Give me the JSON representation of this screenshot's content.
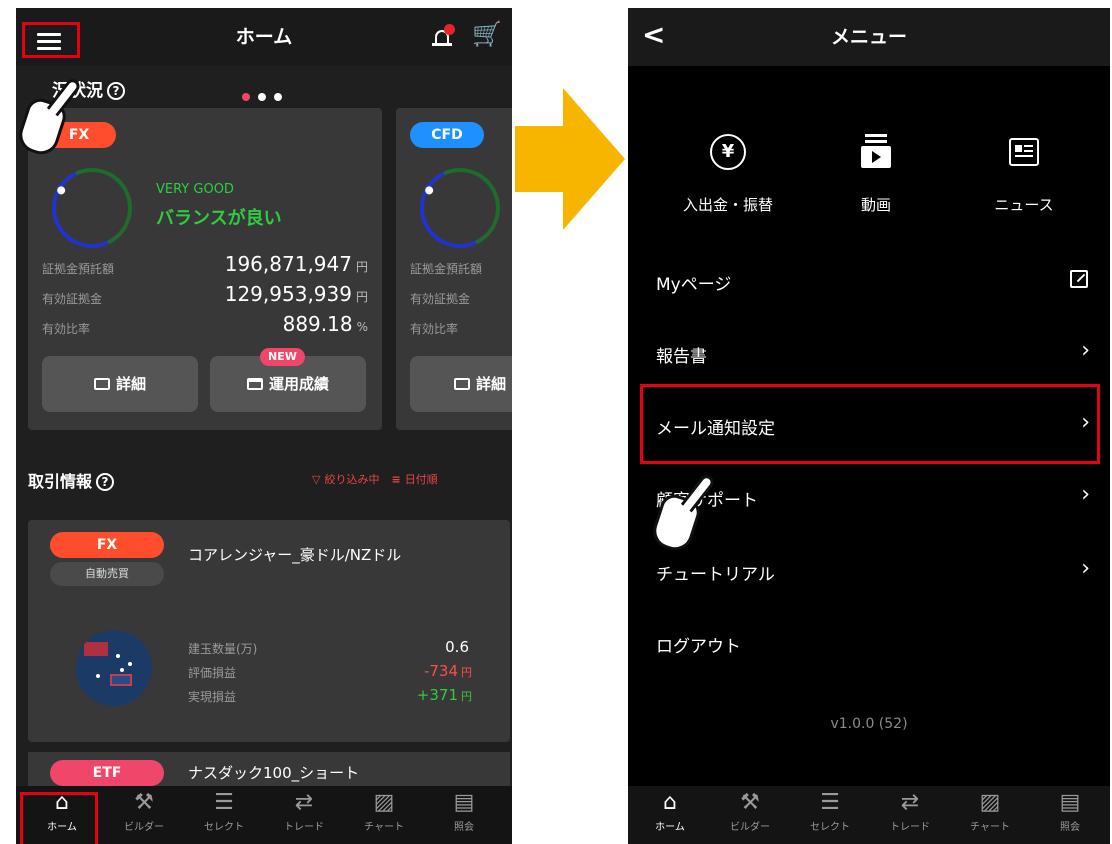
{
  "left": {
    "header": {
      "title": "ホーム"
    },
    "status_section": {
      "title": "況状況"
    },
    "card_fx": {
      "tag": "FX",
      "rating": "VERY GOOD",
      "rating_text": "バランスが良い",
      "rows": [
        {
          "label": "証拠金預託額",
          "value": "196,871,947",
          "unit": "円"
        },
        {
          "label": "有効証拠金",
          "value": "129,953,939",
          "unit": "円"
        },
        {
          "label": "有効比率",
          "value": "889.18",
          "unit": "%"
        }
      ],
      "detail_btn": "詳細",
      "perf_btn": "運用成績",
      "new_badge": "NEW"
    },
    "card_cfd": {
      "tag": "CFD",
      "rows": [
        "証拠金預託額",
        "有効証拠金",
        "有効比率"
      ],
      "detail_btn": "詳細"
    },
    "trade_section": {
      "title": "取引情報",
      "filter": "絞り込み中",
      "sort": "日付順"
    },
    "trade": {
      "tag": "FX",
      "auto": "自動売買",
      "name": "コアレンジャー_豪ドル/NZドル",
      "rows": [
        {
          "label": "建玉数量(万)",
          "value": "0.6",
          "unit": "",
          "color": "#ffffff"
        },
        {
          "label": "評価損益",
          "value": "-734",
          "unit": "円",
          "color": "#ff4d4d"
        },
        {
          "label": "実現損益",
          "value": "+371",
          "unit": "円",
          "color": "#2ecc40"
        }
      ]
    },
    "etf": {
      "tag": "ETF",
      "name": "ナスダック100_ショート"
    },
    "tabs": [
      {
        "icon": "⌂",
        "label": "ホーム"
      },
      {
        "icon": "⚒",
        "label": "ビルダー"
      },
      {
        "icon": "☰",
        "label": "セレクト"
      },
      {
        "icon": "⇄",
        "label": "トレード"
      },
      {
        "icon": "▨",
        "label": "チャート"
      },
      {
        "icon": "▤",
        "label": "照会"
      }
    ]
  },
  "right": {
    "header": {
      "title": "メニュー",
      "back": "<"
    },
    "quick_actions": [
      {
        "icon": "yen-icon",
        "label": "入出金・振替"
      },
      {
        "icon": "video-icon",
        "label": "動画"
      },
      {
        "icon": "news-icon",
        "label": "ニュース"
      }
    ],
    "menu_items": [
      {
        "label": "Myページ"
      },
      {
        "label": "報告書"
      },
      {
        "label": "メール通知設定"
      },
      {
        "label": "顧客サポート"
      },
      {
        "label": "チュートリアル"
      },
      {
        "label": "ログアウト"
      }
    ],
    "version": "v1.0.0 (52)",
    "tabs": [
      {
        "icon": "⌂",
        "label": "ホーム"
      },
      {
        "icon": "⚒",
        "label": "ビルダー"
      },
      {
        "icon": "☰",
        "label": "セレクト"
      },
      {
        "icon": "⇄",
        "label": "トレード"
      },
      {
        "icon": "▨",
        "label": "チャート"
      },
      {
        "icon": "▤",
        "label": "照会"
      }
    ]
  },
  "colors": {
    "accent_red": "#e60012",
    "fx": "#ff4d2e",
    "cfd": "#1e90ff",
    "etf": "#f0466a",
    "arrow": "#f7b500",
    "good": "#2ecc40"
  }
}
